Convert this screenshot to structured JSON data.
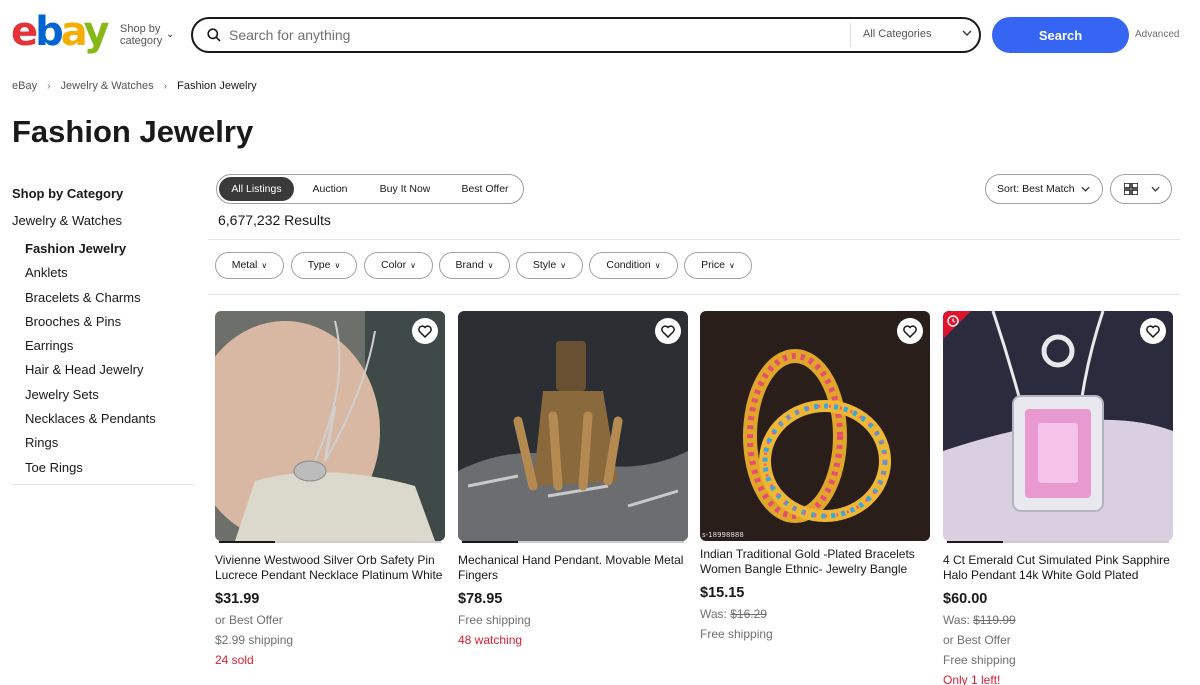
{
  "header": {
    "logo": {
      "e": "e",
      "b": "b",
      "a": "a",
      "y": "y"
    },
    "shop_by_line1": "Shop by",
    "shop_by_line2": "category",
    "search_placeholder": "Search for anything",
    "category_select": "All Categories",
    "search_button": "Search",
    "advanced": "Advanced"
  },
  "breadcrumb": [
    "eBay",
    "Jewelry & Watches",
    "Fashion Jewelry"
  ],
  "page_title": "Fashion Jewelry",
  "sidebar": {
    "heading": "Shop by Category",
    "parent": "Jewelry & Watches",
    "items": [
      "Fashion Jewelry",
      "Anklets",
      "Bracelets & Charms",
      "Brooches & Pins",
      "Earrings",
      "Hair & Head Jewelry",
      "Jewelry Sets",
      "Necklaces & Pendants",
      "Rings",
      "Toe Rings"
    ]
  },
  "tabs": [
    "All Listings",
    "Auction",
    "Buy It Now",
    "Best Offer"
  ],
  "results": "6,677,232 Results",
  "sort": "Sort: Best Match",
  "filters": [
    "Metal",
    "Type",
    "Color",
    "Brand",
    "Style",
    "Condition",
    "Price"
  ],
  "products": [
    {
      "title": "Vivienne Westwood Silver Orb Safety Pin Lucrece Pendant Necklace Platinum White",
      "price": "$31.99",
      "lines": [
        "or Best Offer",
        "$2.99 shipping"
      ],
      "alert": "24 sold"
    },
    {
      "title": "Mechanical Hand Pendant. Movable Metal Fingers",
      "price": "$78.95",
      "lines": [
        "Free shipping"
      ],
      "alert": "48 watching"
    },
    {
      "title": "Indian Traditional Gold -Plated Bracelets Women Bangle Ethnic- Jewelry Bangle",
      "price": "$15.15",
      "was_label": "Was:",
      "was_price": "$16.29",
      "lines": [
        "Free shipping"
      ],
      "image_text": "s-18998888"
    },
    {
      "title": "4 Ct Emerald Cut Simulated Pink Sapphire Halo Pendant 14k White Gold Plated",
      "price": "$60.00",
      "was_label": "Was:",
      "was_price": "$119.99",
      "lines": [
        "or Best Offer",
        "Free shipping"
      ],
      "alert": "Only 1 left!"
    }
  ],
  "colors": {
    "search_button": "#3665f3",
    "alert_red": "#dd1e31",
    "logo_e": "#e53238",
    "logo_b": "#0064d2",
    "logo_a": "#f5af02",
    "logo_y": "#86b817"
  }
}
